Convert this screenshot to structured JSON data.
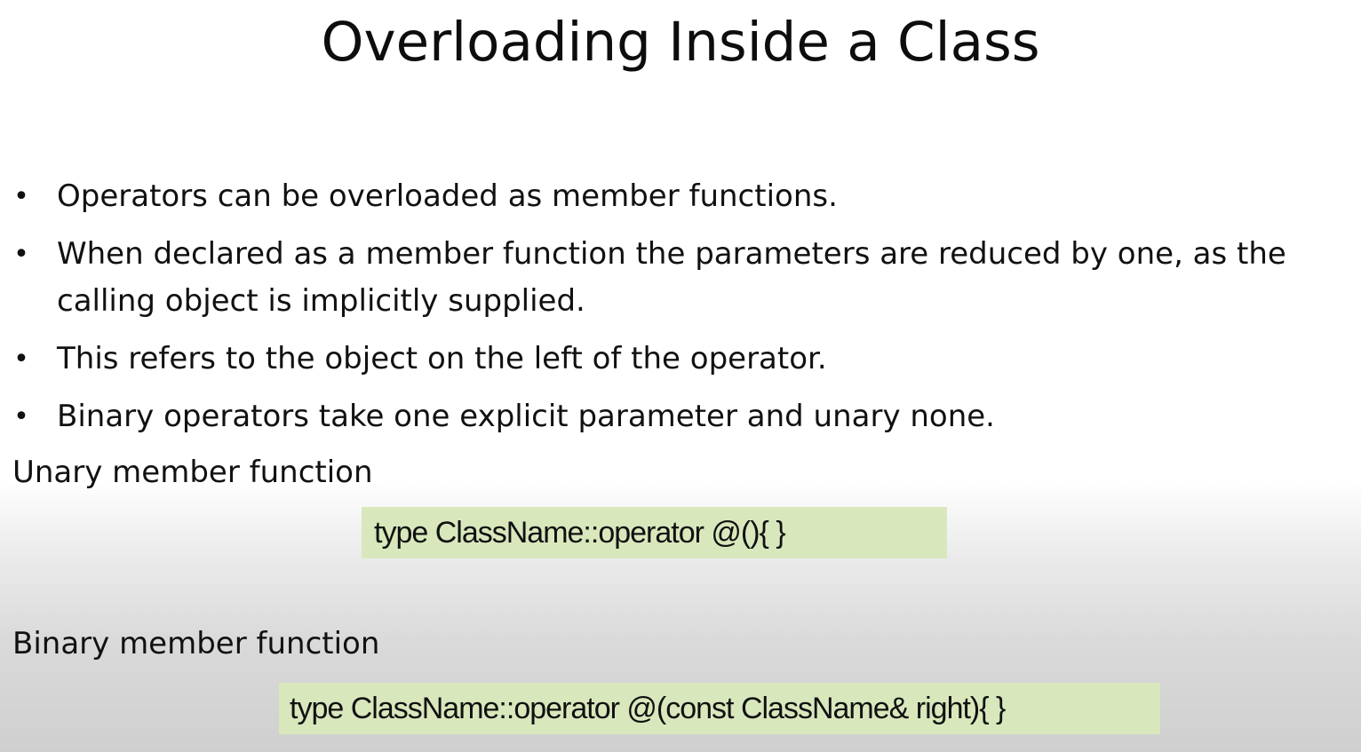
{
  "slide": {
    "title": "Overloading Inside a Class",
    "bullets": [
      {
        "text": "Operators can be overloaded as member functions."
      },
      {
        "text": "When declared as a member function the parameters are reduced by one, as the calling object is implicitly supplied."
      },
      {
        "text": "This refers to the object on the left of the operator."
      },
      {
        "text": "Binary operators take one explicit parameter and unary none."
      }
    ],
    "bullet_glyph": "•",
    "unary_label": "Unary member function",
    "unary_code": "type ClassName::operator @(){ }",
    "binary_label": "Binary member function",
    "binary_code": "type ClassName::operator @(const ClassName& right){ }",
    "colors": {
      "code_background": "#d9e8bc",
      "text": "#111111"
    }
  }
}
